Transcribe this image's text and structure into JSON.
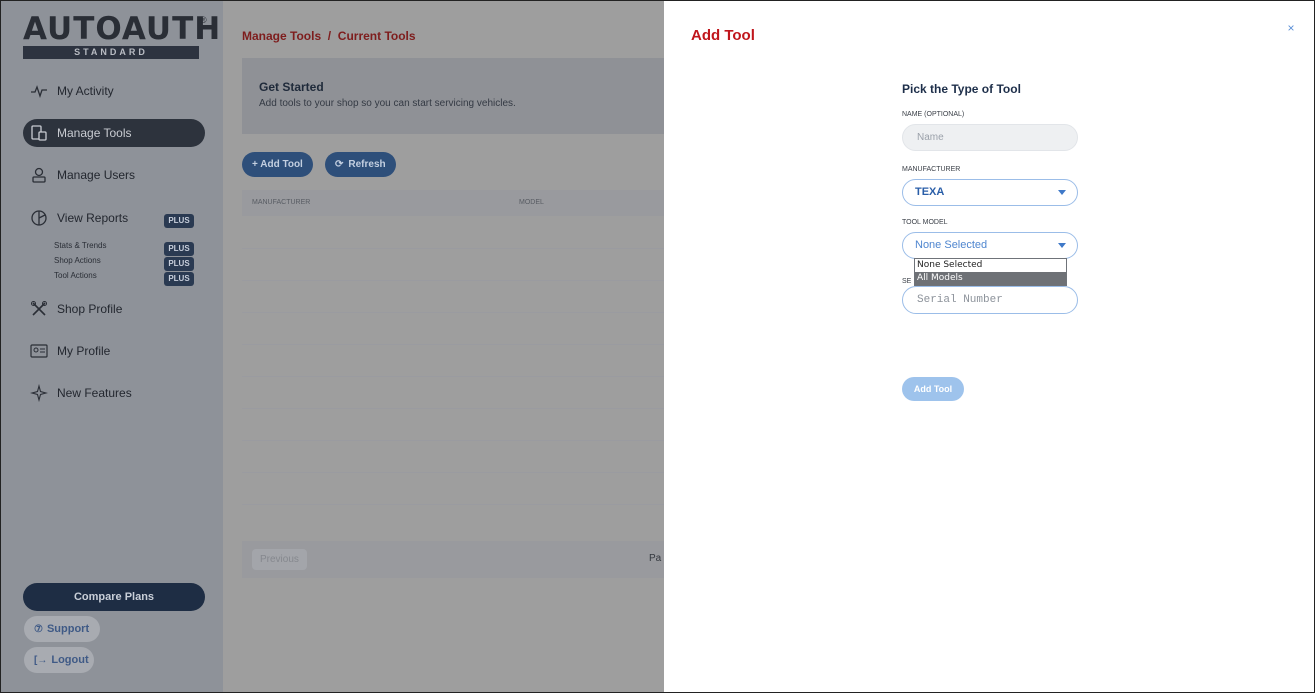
{
  "sidebar": {
    "logo": {
      "text": "AUTOAUTH",
      "tier": "STANDARD",
      "reg": "®"
    },
    "items": [
      {
        "label": "My Activity",
        "icon": "activity-icon"
      },
      {
        "label": "Manage Tools",
        "icon": "tools-icon",
        "active": true
      },
      {
        "label": "Manage Users",
        "icon": "users-icon"
      },
      {
        "label": "View Reports",
        "icon": "reports-icon",
        "badge": "PLUS"
      },
      {
        "label": "Shop Profile",
        "icon": "shop-icon"
      },
      {
        "label": "My Profile",
        "icon": "profile-icon"
      },
      {
        "label": "New Features",
        "icon": "sparkle-icon"
      }
    ],
    "sub_items": [
      {
        "label": "Stats & Trends",
        "badge": "PLUS"
      },
      {
        "label": "Shop Actions",
        "badge": "PLUS"
      },
      {
        "label": "Tool Actions",
        "badge": "PLUS"
      }
    ],
    "compare_plans": "Compare Plans",
    "support": "Support",
    "logout": "Logout"
  },
  "main": {
    "breadcrumb": "Manage Tools  /  Current Tools",
    "get_started": {
      "title": "Get Started",
      "desc": "Add tools to your shop so you can start servicing vehicles."
    },
    "add_tool_btn": "+ Add Tool",
    "refresh_btn": "Refresh",
    "columns": [
      "MANUFACTURER",
      "MODEL"
    ],
    "previous": "Previous",
    "page_label": "Pa"
  },
  "modal": {
    "title": "Add Tool",
    "close": "×",
    "form_title": "Pick the Type of Tool",
    "name_label": "NAME (OPTIONAL)",
    "name_placeholder": "Name",
    "manufacturer_label": "MANUFACTURER",
    "manufacturer_value": "TEXA",
    "tool_model_label": "TOOL MODEL",
    "tool_model_value": "None Selected",
    "tool_model_options": [
      "None Selected",
      "All Models"
    ],
    "tool_model_highlighted": "All Models",
    "serial_label_visible": "SE",
    "serial_placeholder": "Serial Number",
    "submit": "Add Tool"
  },
  "colors": {
    "brand_red": "#c0161c",
    "primary_blue": "#2e4f7a",
    "input_border": "#9bbde8",
    "submit_disabled": "#9ec3ec"
  }
}
